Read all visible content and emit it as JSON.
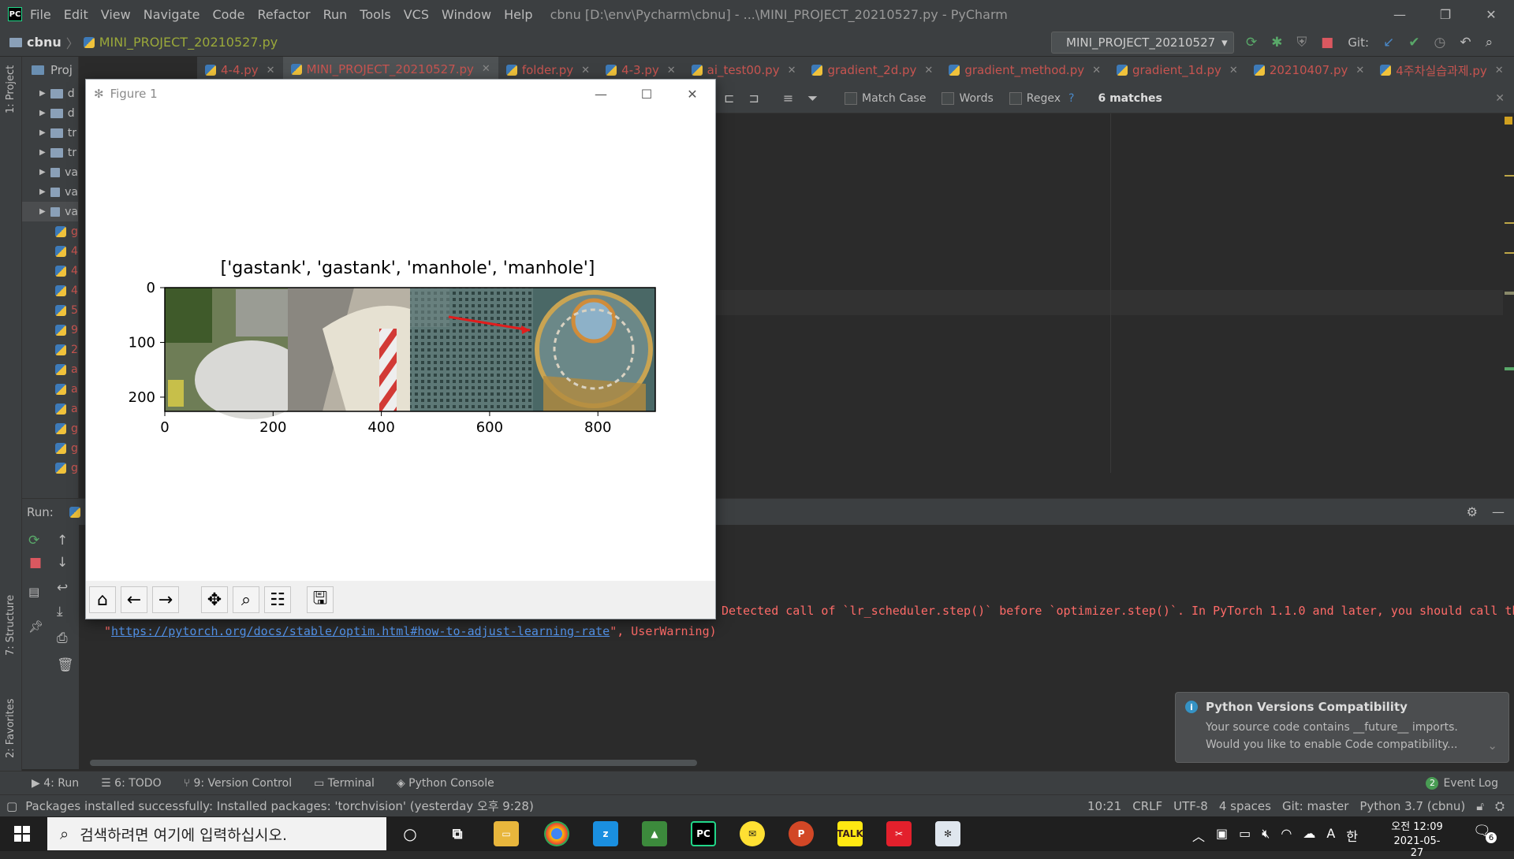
{
  "window": {
    "menu": [
      "File",
      "Edit",
      "View",
      "Navigate",
      "Code",
      "Refactor",
      "Run",
      "Tools",
      "VCS",
      "Window",
      "Help"
    ],
    "title": "cbnu [D:\\env\\Pycharm\\cbnu] - ...\\MINI_PROJECT_20210527.py - PyCharm"
  },
  "navbar": {
    "project": "cbnu",
    "file": "MINI_PROJECT_20210527.py",
    "run_config": "MINI_PROJECT_20210527",
    "git_label": "Git:"
  },
  "project_panel": {
    "header": "Proj",
    "items": [
      "d",
      "d",
      "tr",
      "tr",
      "va",
      "va",
      "va",
      "g",
      "4",
      "4",
      "4",
      "5",
      "9",
      "2",
      "a",
      "a",
      "a",
      "g",
      "g",
      "g"
    ]
  },
  "tabs": [
    {
      "label": "4-4.py",
      "color": "#c75450"
    },
    {
      "label": "MINI_PROJECT_20210527.py",
      "color": "#c75450"
    },
    {
      "label": "folder.py",
      "color": "#c75450"
    },
    {
      "label": "4-3.py",
      "color": "#c75450"
    },
    {
      "label": "ai_test00.py",
      "color": "#c75450"
    },
    {
      "label": "gradient_2d.py",
      "color": "#c75450"
    },
    {
      "label": "gradient_method.py",
      "color": "#c75450"
    },
    {
      "label": "gradient_1d.py",
      "color": "#c75450"
    },
    {
      "label": "20210407.py",
      "color": "#c75450"
    },
    {
      "label": "4주차실습과제.py",
      "color": "#c75450"
    }
  ],
  "findbar": {
    "match_case": "Match Case",
    "words": "Words",
    "regex": "Regex",
    "help": "?",
    "matches": "6 matches"
  },
  "figure": {
    "title": "Figure 1",
    "plot_title": "['gastank', 'gastank', 'manhole', 'manhole']"
  },
  "chart_data": {
    "type": "image",
    "title": "['gastank', 'gastank', 'manhole', 'manhole']",
    "xticks": [
      0,
      200,
      400,
      600,
      800
    ],
    "yticks": [
      0,
      100,
      200
    ],
    "xlim": [
      0,
      906
    ],
    "ylim": [
      226,
      0
    ],
    "panels": [
      "gastank",
      "gastank",
      "manhole",
      "manhole"
    ]
  },
  "run": {
    "label": "Run:",
    "warning": "Detected call of `lr_scheduler.step()` before `optimizer.step()`. In PyTorch 1.1.0 and later, you should call th",
    "link_prefix": "\"",
    "link": "https://pytorch.org/docs/stable/optim.html#how-to-adjust-learning-rate",
    "link_suffix": "\", UserWarning)"
  },
  "notification": {
    "title": "Python Versions Compatibility",
    "line1": "Your source code contains __future__ imports.",
    "line2": "Would you like to enable Code compatibility..."
  },
  "bottom_tools": [
    "4: Run",
    "6: TODO",
    "9: Version Control",
    "Terminal",
    "Python Console"
  ],
  "event_log": {
    "count": "2",
    "label": "Event Log"
  },
  "left_stripe": {
    "project": "1: Project",
    "structure": "7: Structure",
    "favorites": "2: Favorites"
  },
  "status": {
    "message": "Packages installed successfully: Installed packages: 'torchvision' (yesterday 오후 9:28)",
    "position": "10:21",
    "line_sep": "CRLF",
    "encoding": "UTF-8",
    "indent": "4 spaces",
    "git": "Git: master",
    "interpreter": "Python 3.7 (cbnu)"
  },
  "taskbar": {
    "search_placeholder": "검색하려면 여기에 입력하십시오.",
    "time": "오전 12:09",
    "date": "2021-05-27",
    "lang": "A",
    "ime": "한",
    "notif_count": "6"
  }
}
